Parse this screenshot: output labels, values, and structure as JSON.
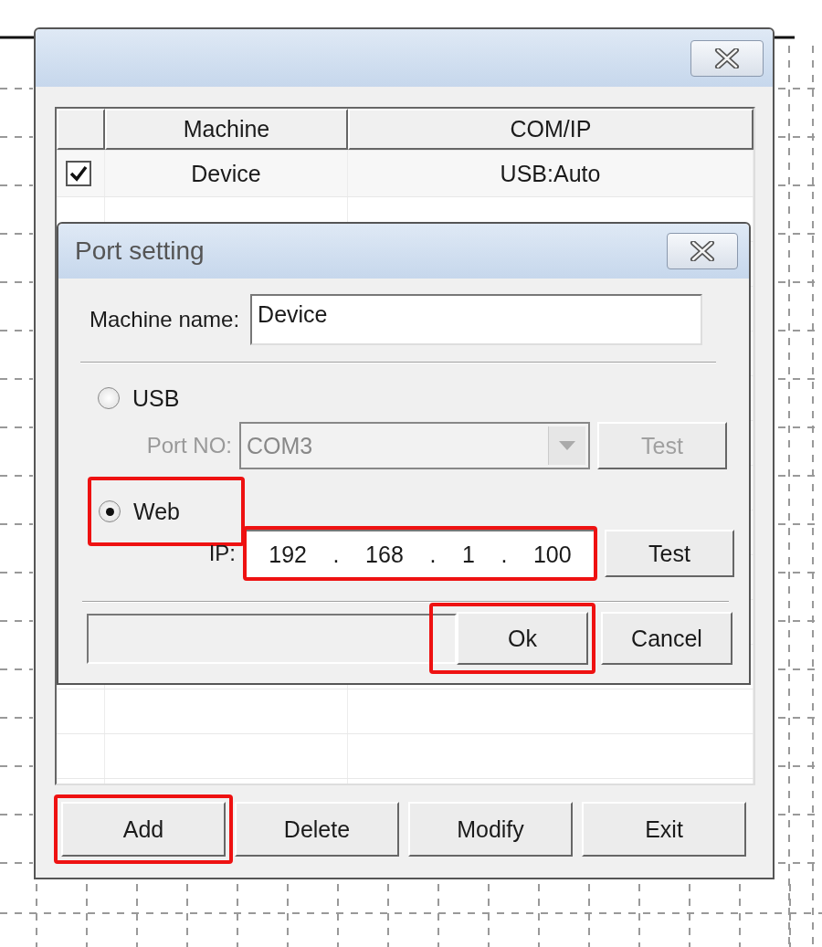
{
  "main_window": {
    "table": {
      "columns": [
        "Machine",
        "COM/IP"
      ],
      "rows": [
        {
          "checked": true,
          "machine": "Device",
          "port": "USB:Auto"
        }
      ]
    },
    "buttons": [
      {
        "label": "Add",
        "highlighted": true
      },
      {
        "label": "Delete",
        "highlighted": false
      },
      {
        "label": "Modify",
        "highlighted": false
      },
      {
        "label": "Exit",
        "highlighted": false
      }
    ]
  },
  "port_dialog": {
    "title": "Port setting",
    "machine_name_label": "Machine name:",
    "machine_name": "Device",
    "usb": {
      "label": "USB",
      "selected": false,
      "highlighted": false
    },
    "port_label": "Port NO:",
    "port_value": "COM3",
    "port_disabled": true,
    "usb_test": {
      "label": "Test",
      "disabled": true
    },
    "web": {
      "label": "Web",
      "selected": true,
      "highlighted": true
    },
    "ip_label": "IP:",
    "ip_parts": [
      "192",
      ".",
      "168",
      ".",
      "1",
      ".",
      "100"
    ],
    "ip_highlighted": true,
    "web_test": {
      "label": "Test",
      "disabled": false
    },
    "buttons": [
      {
        "label": "Ok",
        "highlighted": true
      },
      {
        "label": "Cancel",
        "highlighted": false
      }
    ]
  }
}
